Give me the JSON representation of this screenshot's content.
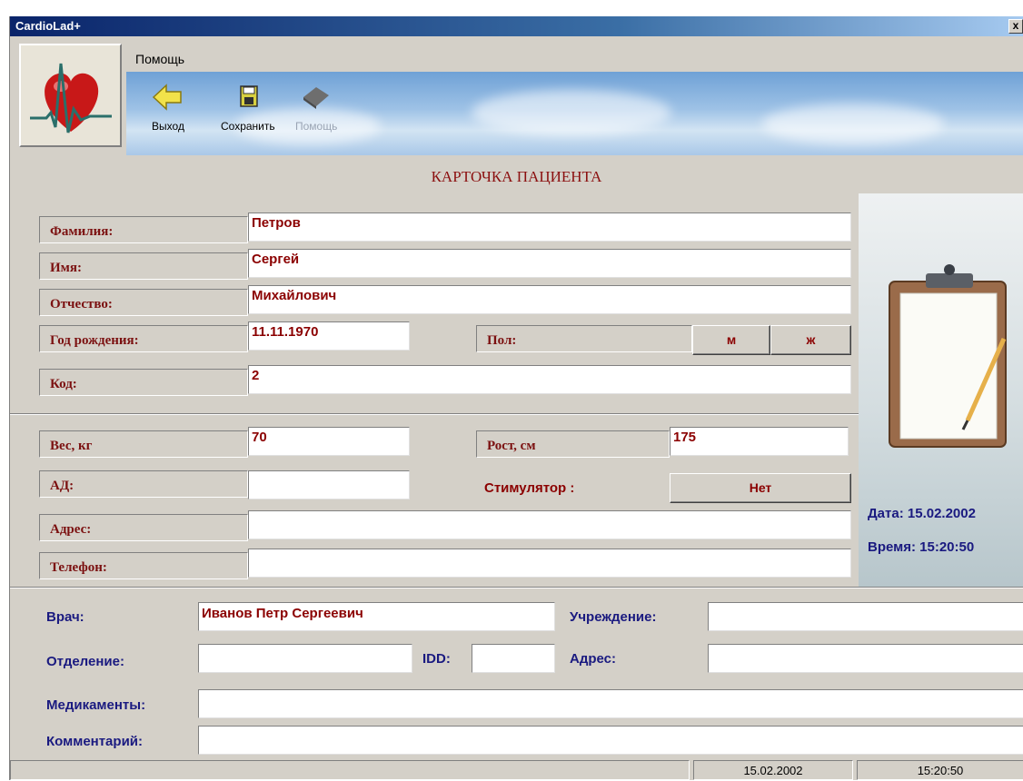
{
  "window": {
    "title": "CardioLad+",
    "close_label": "x"
  },
  "menu": {
    "help": "Помощь"
  },
  "toolbar": {
    "exit": "Выход",
    "save": "Сохранить",
    "help": "Помощь"
  },
  "form": {
    "heading": "КАРТОЧКА ПАЦИЕНТА",
    "surname_label": "Фамилия:",
    "surname": "Петров",
    "name_label": "Имя:",
    "name": "Сергей",
    "patronymic_label": "Отчество:",
    "patronymic": "Михайлович",
    "birth_label": "Год рождения:",
    "birth": "11.11.1970",
    "sex_label": "Пол:",
    "sex_m": "м",
    "sex_f": "ж",
    "code_label": "Код:",
    "code": "2",
    "weight_label": "Вес, кг",
    "weight": "70",
    "height_label": "Рост, см",
    "height": "175",
    "bp_label": "АД:",
    "bp": "",
    "stim_label": "Стимулятор :",
    "stim_value": "Нет",
    "address_label": "Адрес:",
    "address": "",
    "phone_label": "Телефон:",
    "phone": ""
  },
  "side": {
    "date_text": "Дата:  15.02.2002",
    "time_text": "Время: 15:20:50"
  },
  "doctor": {
    "doctor_label": "Врач:",
    "doctor": "Иванов Петр Сергеевич",
    "institution_label": "Учреждение:",
    "institution": "",
    "department_label": "Отделение:",
    "department": "",
    "idd_label": "IDD:",
    "idd": "",
    "address_label": "Адрес:",
    "address": "",
    "meds_label": "Медикаменты:",
    "meds": "",
    "comment_label": "Комментарий:",
    "comment": ""
  },
  "status": {
    "date": "15.02.2002",
    "time": "15:20:50"
  },
  "colors": {
    "label_red": "#7b1010",
    "value_red": "#8b0000",
    "label_blue": "#1a1a80"
  },
  "icons": [
    "heart-ecg-logo-icon",
    "exit-arrow-icon",
    "save-disk-icon",
    "help-book-icon",
    "clipboard-pencil-icon"
  ]
}
